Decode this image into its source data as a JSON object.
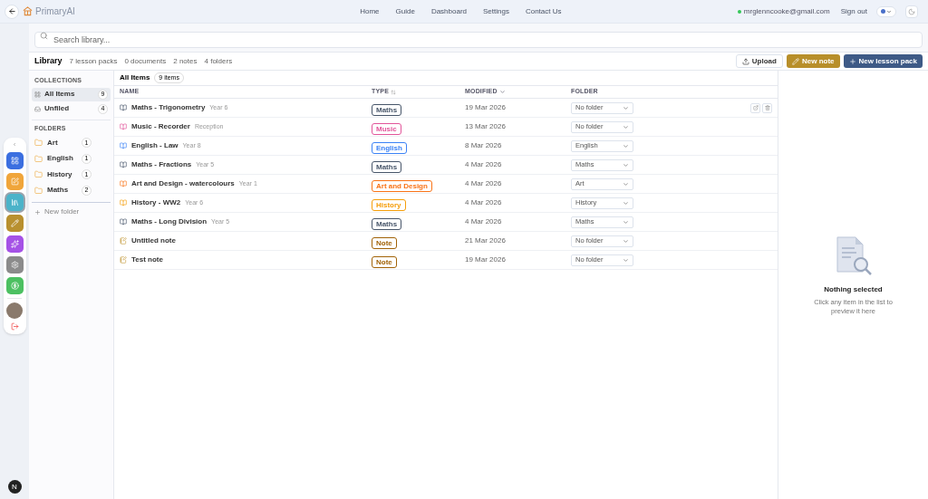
{
  "nav": {
    "brand": "PrimaryAI",
    "links": [
      "Home",
      "Guide",
      "Dashboard",
      "Settings",
      "Contact Us"
    ],
    "email": "mrglenncooke@gmail.com",
    "sign_out": "Sign out"
  },
  "dock": {
    "collapse": "‹",
    "apps": [
      {
        "color": "#3b6fe0",
        "selected": false
      },
      {
        "color": "#f0a53a",
        "selected": false
      },
      {
        "color": "#4bb3c9",
        "selected": true
      },
      {
        "color": "#b8902f",
        "selected": false
      },
      {
        "color": "#a552e6",
        "selected": false
      },
      {
        "color": "#8b8b8b",
        "selected": false
      },
      {
        "color": "#4cc061",
        "selected": false
      }
    ],
    "badge": "N"
  },
  "search": {
    "placeholder": "Search library..."
  },
  "library": {
    "title": "Library",
    "stats": [
      "7 lesson packs",
      "0 documents",
      "2 notes",
      "4 folders"
    ],
    "buttons": [
      {
        "kind": "upload",
        "label": "Upload"
      },
      {
        "kind": "note",
        "label": "New note"
      },
      {
        "kind": "pack",
        "label": "New lesson pack"
      }
    ]
  },
  "sidebar": {
    "collections_heading": "COLLECTIONS",
    "collections": [
      {
        "kind": "all",
        "label": "All Items",
        "count": "9",
        "selected": true
      },
      {
        "kind": "unfiled",
        "label": "Unfiled",
        "count": "4",
        "selected": false
      }
    ],
    "folders_heading": "FOLDERS",
    "folders": [
      {
        "label": "Art",
        "count": "1",
        "selected": false
      },
      {
        "label": "English",
        "count": "1",
        "selected": false
      },
      {
        "label": "History",
        "count": "1",
        "selected": false
      },
      {
        "label": "Maths",
        "count": "2",
        "selected": false
      }
    ],
    "new_folder": "New folder"
  },
  "table": {
    "title": "All Items",
    "count": "9 items",
    "columns": [
      "NAME",
      "TYPE",
      "MODIFIED",
      "FOLDER"
    ],
    "rows": [
      {
        "kind": "lesson",
        "name": "Maths - Trigonometry",
        "sub": "Year 6",
        "type": "Maths",
        "color": "#475569",
        "modified": "19 Mar 2026",
        "folder": "No folder",
        "hovered": true
      },
      {
        "kind": "lesson",
        "name": "Music - Recorder",
        "sub": "Reception",
        "type": "Music",
        "color": "#e2559a",
        "modified": "13 Mar 2026",
        "folder": "No folder",
        "hovered": false
      },
      {
        "kind": "lesson",
        "name": "English - Law",
        "sub": "Year 8",
        "type": "English",
        "color": "#3b82f6",
        "modified": "8 Mar 2026",
        "folder": "English",
        "hovered": false
      },
      {
        "kind": "lesson",
        "name": "Maths - Fractions",
        "sub": "Year 5",
        "type": "Maths",
        "color": "#475569",
        "modified": "4 Mar 2026",
        "folder": "Maths",
        "hovered": false
      },
      {
        "kind": "lesson",
        "name": "Art and Design - watercolours",
        "sub": "Year 1",
        "type": "Art and Design",
        "color": "#f97316",
        "modified": "4 Mar 2026",
        "folder": "Art",
        "hovered": false
      },
      {
        "kind": "lesson",
        "name": "History - WW2",
        "sub": "Year 6",
        "type": "History",
        "color": "#f59e0b",
        "modified": "4 Mar 2026",
        "folder": "History",
        "hovered": false
      },
      {
        "kind": "lesson",
        "name": "Maths - Long Division",
        "sub": "Year 5",
        "type": "Maths",
        "color": "#475569",
        "modified": "4 Mar 2026",
        "folder": "Maths",
        "hovered": false
      },
      {
        "kind": "note",
        "name": "Untitled note",
        "type": "Note",
        "color": "#a16207",
        "modified": "21 Mar 2026",
        "folder": "No folder",
        "hovered": false
      },
      {
        "kind": "note",
        "name": "Test note",
        "type": "Note",
        "color": "#a16207",
        "modified": "19 Mar 2026",
        "folder": "No folder",
        "hovered": false
      }
    ]
  },
  "preview": {
    "title": "Nothing selected",
    "hint": "Click any item in the list to preview it here"
  }
}
